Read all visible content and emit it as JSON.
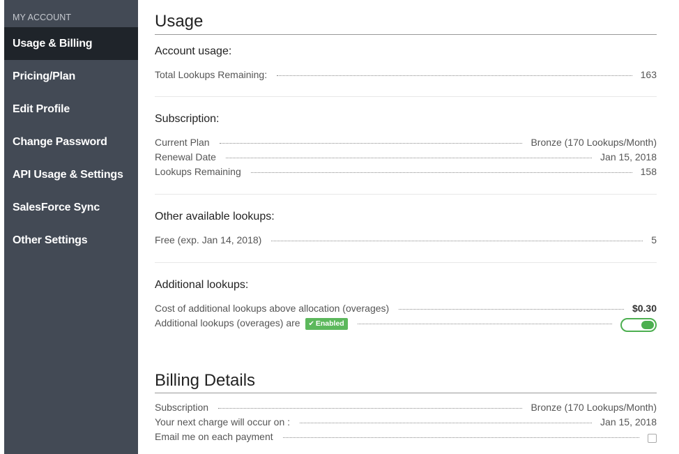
{
  "sidebar": {
    "header": "MY ACCOUNT",
    "items": [
      {
        "label": "Usage & Billing",
        "active": true
      },
      {
        "label": "Pricing/Plan"
      },
      {
        "label": "Edit Profile"
      },
      {
        "label": "Change Password"
      },
      {
        "label": "API Usage & Settings"
      },
      {
        "label": "SalesForce Sync"
      },
      {
        "label": "Other Settings"
      }
    ]
  },
  "usage": {
    "title": "Usage",
    "account": {
      "title": "Account usage:",
      "rows": [
        {
          "label": "Total Lookups Remaining:",
          "value": "163"
        }
      ]
    },
    "subscription": {
      "title": "Subscription:",
      "rows": [
        {
          "label": "Current Plan",
          "value": "Bronze (170 Lookups/Month)"
        },
        {
          "label": "Renewal Date",
          "value": "Jan 15, 2018"
        },
        {
          "label": "Lookups Remaining",
          "value": "158"
        }
      ]
    },
    "other": {
      "title": "Other available lookups:",
      "rows": [
        {
          "label": "Free (exp. Jan 14, 2018)",
          "value": "5"
        }
      ]
    },
    "additional": {
      "title": "Additional lookups:",
      "cost_label": "Cost of additional lookups above allocation (overages)",
      "cost_value": "$0.30",
      "overages_label": "Additional lookups (overages) are",
      "badge": "Enabled",
      "toggle_on": true
    }
  },
  "billing": {
    "title": "Billing Details",
    "subscription_label": "Subscription",
    "subscription_value": "Bronze (170 Lookups/Month)",
    "next_charge_label": "Your next charge will occur on :",
    "next_charge_value": "Jan 15, 2018",
    "email_label": "Email me on each payment",
    "email_checked": false
  },
  "colors": {
    "sidebar_bg": "#434a55",
    "sidebar_active_bg": "#1f242a",
    "accent_green": "#5cb85c"
  }
}
